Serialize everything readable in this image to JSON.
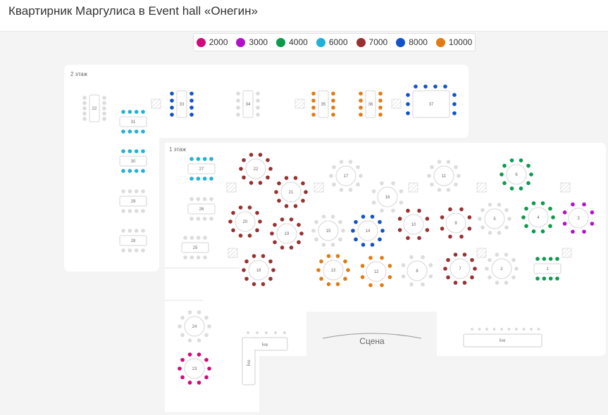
{
  "page_title": "Квартирник Маргулиса в Event hall «Онегин»",
  "legend": [
    {
      "label": "2000",
      "color": "#d0097c"
    },
    {
      "label": "3000",
      "color": "#b112c9"
    },
    {
      "label": "4000",
      "color": "#0d9a4b"
    },
    {
      "label": "6000",
      "color": "#1fb1d8"
    },
    {
      "label": "7000",
      "color": "#993030"
    },
    {
      "label": "8000",
      "color": "#1152c9"
    },
    {
      "label": "10000",
      "color": "#e07b12"
    }
  ],
  "floors": {
    "second": "2 этаж",
    "first": "1 этаж"
  },
  "stage_label": "Сцена",
  "bar_label": "Бар",
  "tables": [
    {
      "n": "22",
      "cat": "none"
    },
    {
      "n": "31",
      "cat": "6000"
    },
    {
      "n": "30",
      "cat": "6000"
    },
    {
      "n": "29",
      "cat": "none"
    },
    {
      "n": "28",
      "cat": "none"
    },
    {
      "n": "33",
      "cat": "8000"
    },
    {
      "n": "34",
      "cat": "none"
    },
    {
      "n": "35",
      "cat": "10000"
    },
    {
      "n": "36",
      "cat": "10000"
    },
    {
      "n": "37",
      "cat": "8000"
    },
    {
      "n": "27",
      "cat": "6000"
    },
    {
      "n": "26",
      "cat": "none"
    },
    {
      "n": "25",
      "cat": "none"
    },
    {
      "n": "22",
      "cat": "7000"
    },
    {
      "n": "21",
      "cat": "7000"
    },
    {
      "n": "20",
      "cat": "7000"
    },
    {
      "n": "19",
      "cat": "7000"
    },
    {
      "n": "18",
      "cat": "7000"
    },
    {
      "n": "17",
      "cat": "none"
    },
    {
      "n": "16",
      "cat": "none"
    },
    {
      "n": "15",
      "cat": "none"
    },
    {
      "n": "14",
      "cat": "8000"
    },
    {
      "n": "13",
      "cat": "10000"
    },
    {
      "n": "12",
      "cat": "10000"
    },
    {
      "n": "11",
      "cat": "none"
    },
    {
      "n": "10",
      "cat": "7000"
    },
    {
      "n": "9",
      "cat": "7000"
    },
    {
      "n": "8",
      "cat": "none"
    },
    {
      "n": "7",
      "cat": "7000"
    },
    {
      "n": "6",
      "cat": "4000"
    },
    {
      "n": "5",
      "cat": "none"
    },
    {
      "n": "4",
      "cat": "4000"
    },
    {
      "n": "3",
      "cat": "3000"
    },
    {
      "n": "2",
      "cat": "none"
    },
    {
      "n": "1",
      "cat": "4000"
    },
    {
      "n": "24",
      "cat": "none"
    },
    {
      "n": "23",
      "cat": "2000"
    }
  ]
}
